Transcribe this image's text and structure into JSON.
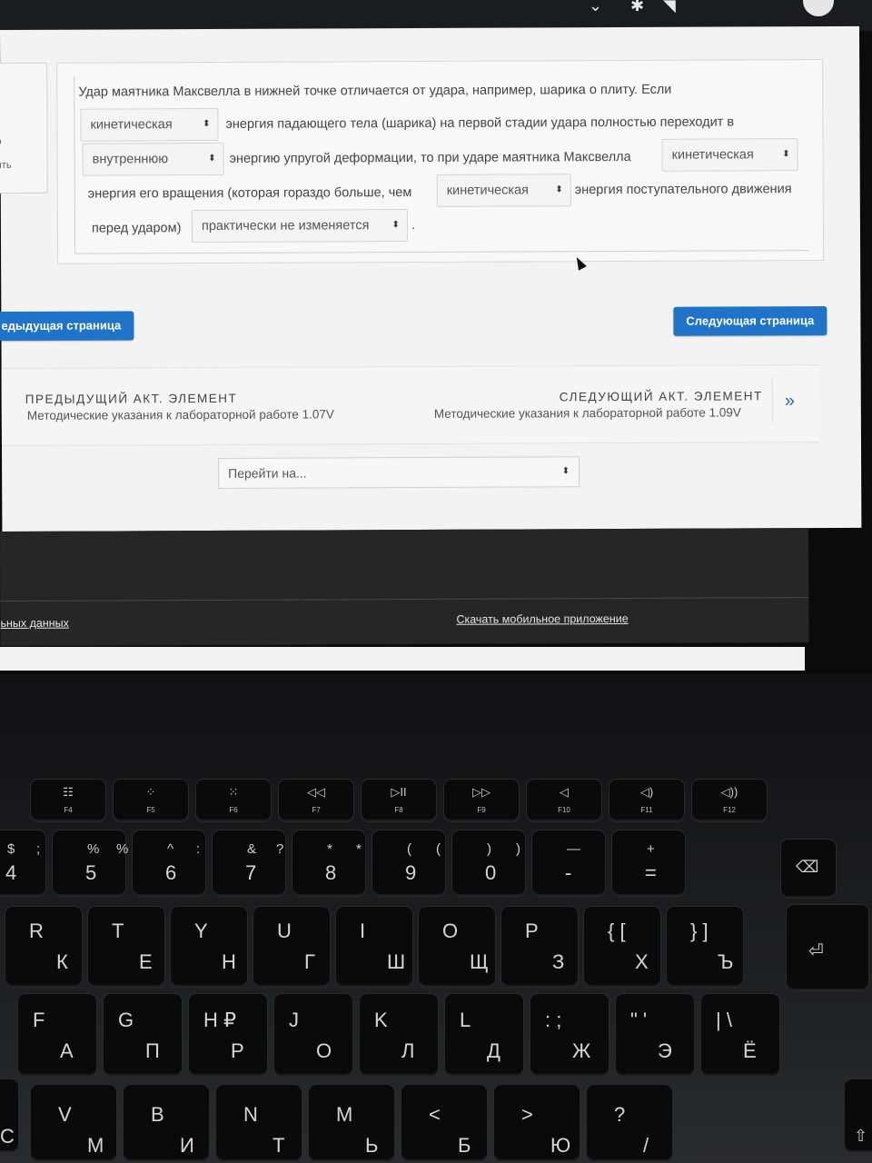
{
  "quiz": {
    "line1": "Удар маятника Максвелла в нижней точке отличается от удара, например, шарика о плиту. Если",
    "dd1": "кинетическая",
    "line2": "энергия падающего тела (шарика) на первой стадии удара полностью переходит в",
    "dd2": "внутреннюю",
    "line3": "энергию упругой деформации, то при ударе маятника Максвелла",
    "dd3": "кинетическая",
    "line4a": "энергия его вращения (которая гораздо больше, чем",
    "dd4": "кинетическая",
    "line4b": "энергия поступательного движения",
    "line5a": "перед ударом)",
    "dd5": "практически не изменяется",
    "line5b": "."
  },
  "left_fragments": {
    "a": "о",
    "b": "ить",
    "c": "і"
  },
  "buttons": {
    "prev_page": "едыдущая страница",
    "next_page": "Следующая страница"
  },
  "activity_nav": {
    "prev_heading": "ПРЕДЫДУЩИЙ АКТ. ЭЛЕМЕНТ",
    "prev_link": "Методические указания к лабораторной работе 1.07V",
    "next_heading": "СЛЕДУЮЩИЙ АКТ. ЭЛЕМЕНТ",
    "next_link": "Методические указания к лабораторной работе 1.09V",
    "next_arrow": "»"
  },
  "jump_select": {
    "placeholder": "Перейти на..."
  },
  "footer": {
    "left_link": "ьных данных",
    "mobile_link": "Скачать мобильное приложение"
  },
  "keyboard": {
    "fkeys": [
      {
        "icon": "☷",
        "label": "F4"
      },
      {
        "icon": "⁘",
        "label": "F5"
      },
      {
        "icon": "⁙",
        "label": "F6"
      },
      {
        "icon": "◁◁",
        "label": "F7"
      },
      {
        "icon": "▷II",
        "label": "F8"
      },
      {
        "icon": "▷▷",
        "label": "F9"
      },
      {
        "icon": "◁",
        "label": "F10"
      },
      {
        "icon": "◁)",
        "label": "F11"
      },
      {
        "icon": "◁))",
        "label": "F12"
      }
    ],
    "numrow": [
      {
        "top": "$",
        "main": "4",
        "ru": ";"
      },
      {
        "top": "%",
        "main": "5",
        "ru": "%"
      },
      {
        "top": "^",
        "main": "6",
        "ru": ":"
      },
      {
        "top": "&",
        "main": "7",
        "ru": "?"
      },
      {
        "top": "*",
        "main": "8",
        "ru": "*"
      },
      {
        "top": "(",
        "main": "9",
        "ru": "("
      },
      {
        "top": ")",
        "main": "0",
        "ru": ")"
      },
      {
        "top": "—",
        "main": "-",
        "ru": ""
      },
      {
        "top": "+",
        "main": "=",
        "ru": ""
      }
    ],
    "qrow": [
      {
        "en": "R",
        "ru": "К"
      },
      {
        "en": "T",
        "ru": "Е"
      },
      {
        "en": "Y",
        "ru": "Н"
      },
      {
        "en": "U",
        "ru": "Г"
      },
      {
        "en": "I",
        "ru": "Ш"
      },
      {
        "en": "O",
        "ru": "Щ"
      },
      {
        "en": "P",
        "ru": "З"
      },
      {
        "en": "{ [",
        "ru": "Х"
      },
      {
        "en": "} ]",
        "ru": "Ъ"
      }
    ],
    "arow": [
      {
        "en": "F",
        "ru": "А"
      },
      {
        "en": "G",
        "ru": "П"
      },
      {
        "en": "H ₽",
        "ru": "Р"
      },
      {
        "en": "J",
        "ru": "О"
      },
      {
        "en": "K",
        "ru": "Л"
      },
      {
        "en": "L",
        "ru": "Д"
      },
      {
        "en": ": ;",
        "ru": "Ж"
      },
      {
        "en": "\" '",
        "ru": "Э"
      },
      {
        "en": "| \\",
        "ru": "Ё"
      }
    ],
    "zrow": [
      {
        "en": "V",
        "ru": "М"
      },
      {
        "en": "B",
        "ru": "И"
      },
      {
        "en": "N",
        "ru": "Т"
      },
      {
        "en": "M",
        "ru": "Ь"
      },
      {
        "en": "<",
        "ru": "Б"
      },
      {
        "en": ">",
        "ru": "Ю"
      },
      {
        "en": "?",
        "ru": "/"
      }
    ],
    "partial_c": "С"
  }
}
